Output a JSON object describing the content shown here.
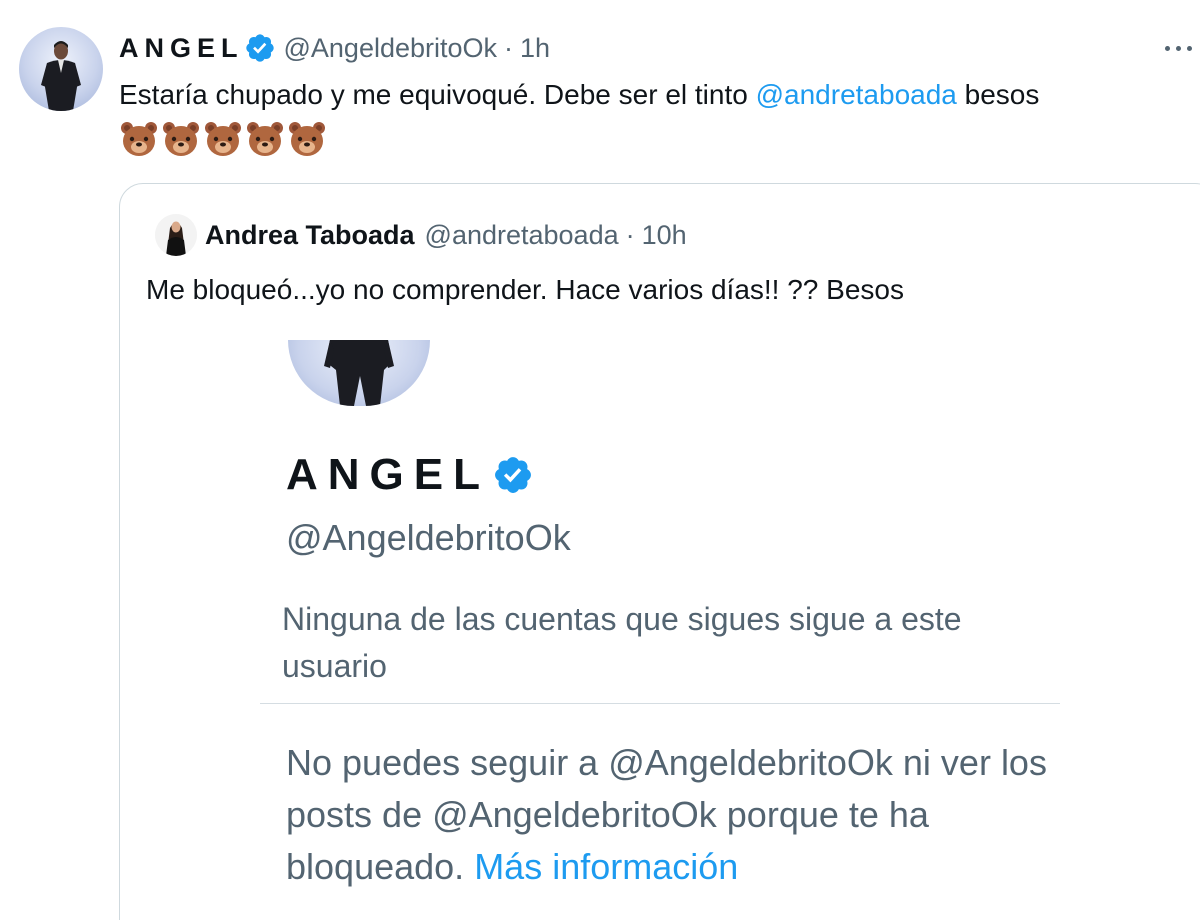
{
  "tweet": {
    "author": {
      "display_name": "ANGEL",
      "handle": "@AngeldebritoOk",
      "verified": true,
      "avatar_icon": "profile-photo-man-in-suit"
    },
    "separator": "·",
    "time": "1h",
    "text_before": "Estaría chupado y me equivoqué. Debe ser el tinto ",
    "mention": "@andretaboada",
    "text_after": " besos",
    "emojis": [
      "bear-face",
      "bear-face",
      "bear-face",
      "bear-face",
      "bear-face"
    ],
    "more_icon": "more-options-icon"
  },
  "quote": {
    "author": {
      "display_name": "Andrea Taboada",
      "handle": "@andretaboada",
      "avatar_icon": "profile-photo-woman"
    },
    "separator": "·",
    "time": "10h",
    "text": "Me bloqueó...yo no comprender. Hace varios días!! ?? Besos",
    "screenshot": {
      "name": "ANGEL",
      "verified": true,
      "handle": "@AngeldebritoOk",
      "follow_info": "Ninguna de las cuentas que sigues sigue a este usuario",
      "blocked_text": "No puedes seguir a @AngeldebritoOk ni ver los posts de @AngeldebritoOk porque te ha bloqueado.",
      "more_info_link": "Más información"
    }
  },
  "colors": {
    "link": "#1d9bf0",
    "secondary_text": "#536471",
    "primary_text": "#0f1419",
    "border": "#cfd9de"
  }
}
